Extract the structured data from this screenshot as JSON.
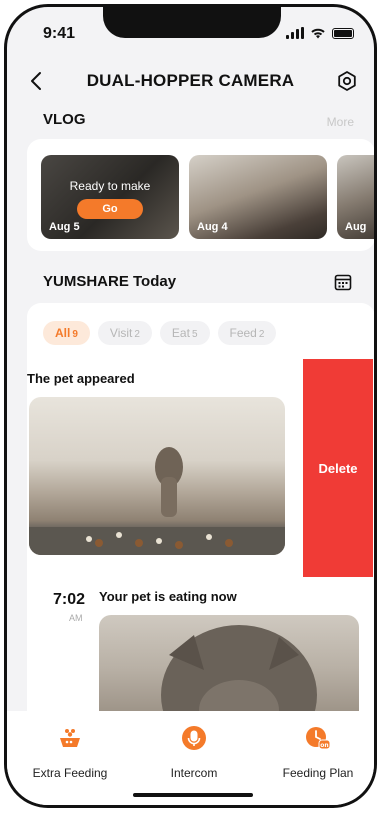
{
  "status": {
    "time": "9:41"
  },
  "header": {
    "title": "DUAL-HOPPER CAMERA"
  },
  "vlog": {
    "title": "VLOG",
    "more": "More",
    "items": [
      {
        "date": "Aug 5",
        "overlay_text": "Ready to make",
        "button": "Go"
      },
      {
        "date": "Aug 4"
      },
      {
        "date": "Aug"
      }
    ]
  },
  "today": {
    "title": "YUMSHARE Today",
    "filters": [
      {
        "label": "All",
        "count": "9"
      },
      {
        "label": "Visit",
        "count": "2"
      },
      {
        "label": "Eat",
        "count": "5"
      },
      {
        "label": "Feed",
        "count": "2"
      }
    ],
    "events": [
      {
        "title": "The pet appeared",
        "action": "Delete"
      },
      {
        "time": "7:02",
        "ampm": "AM",
        "title": "Your pet is eating now"
      }
    ]
  },
  "bottom_tabs": [
    {
      "label": "Extra Feeding",
      "icon": "paw-bowl-icon"
    },
    {
      "label": "Intercom",
      "icon": "microphone-icon"
    },
    {
      "label": "Feeding Plan",
      "icon": "clock-on-icon"
    }
  ],
  "colors": {
    "accent": "#f47a2a",
    "delete": "#f03b36",
    "background": "#f3f3f5"
  }
}
